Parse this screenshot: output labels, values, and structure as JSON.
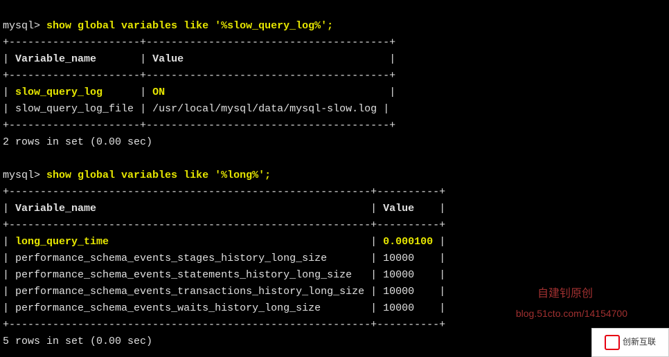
{
  "prompt": "mysql>",
  "query1": {
    "command": "show global variables like '%slow_query_log%';",
    "header_col1": "Variable_name",
    "header_col2": "Value",
    "rows": [
      {
        "name": "slow_query_log",
        "value": "ON",
        "highlight": true
      },
      {
        "name": "slow_query_log_file",
        "value": "/usr/local/mysql/data/mysql-slow.log",
        "highlight": false
      }
    ],
    "footer": "2 rows in set (0.00 sec)"
  },
  "query2": {
    "command": "show global variables like '%long%';",
    "header_col1": "Variable_name",
    "header_col2": "Value",
    "rows": [
      {
        "name": "long_query_time",
        "value": "0.000100",
        "highlight": true
      },
      {
        "name": "performance_schema_events_stages_history_long_size",
        "value": "10000",
        "highlight": false
      },
      {
        "name": "performance_schema_events_statements_history_long_size",
        "value": "10000",
        "highlight": false
      },
      {
        "name": "performance_schema_events_transactions_history_long_size",
        "value": "10000",
        "highlight": false
      },
      {
        "name": "performance_schema_events_waits_history_long_size",
        "value": "10000",
        "highlight": false
      }
    ],
    "footer": "5 rows in set (0.00 sec)"
  },
  "watermark": {
    "text1": "自建钊原创",
    "text2": "blog.51cto.com/14154700",
    "logo_text": "创新互联"
  }
}
